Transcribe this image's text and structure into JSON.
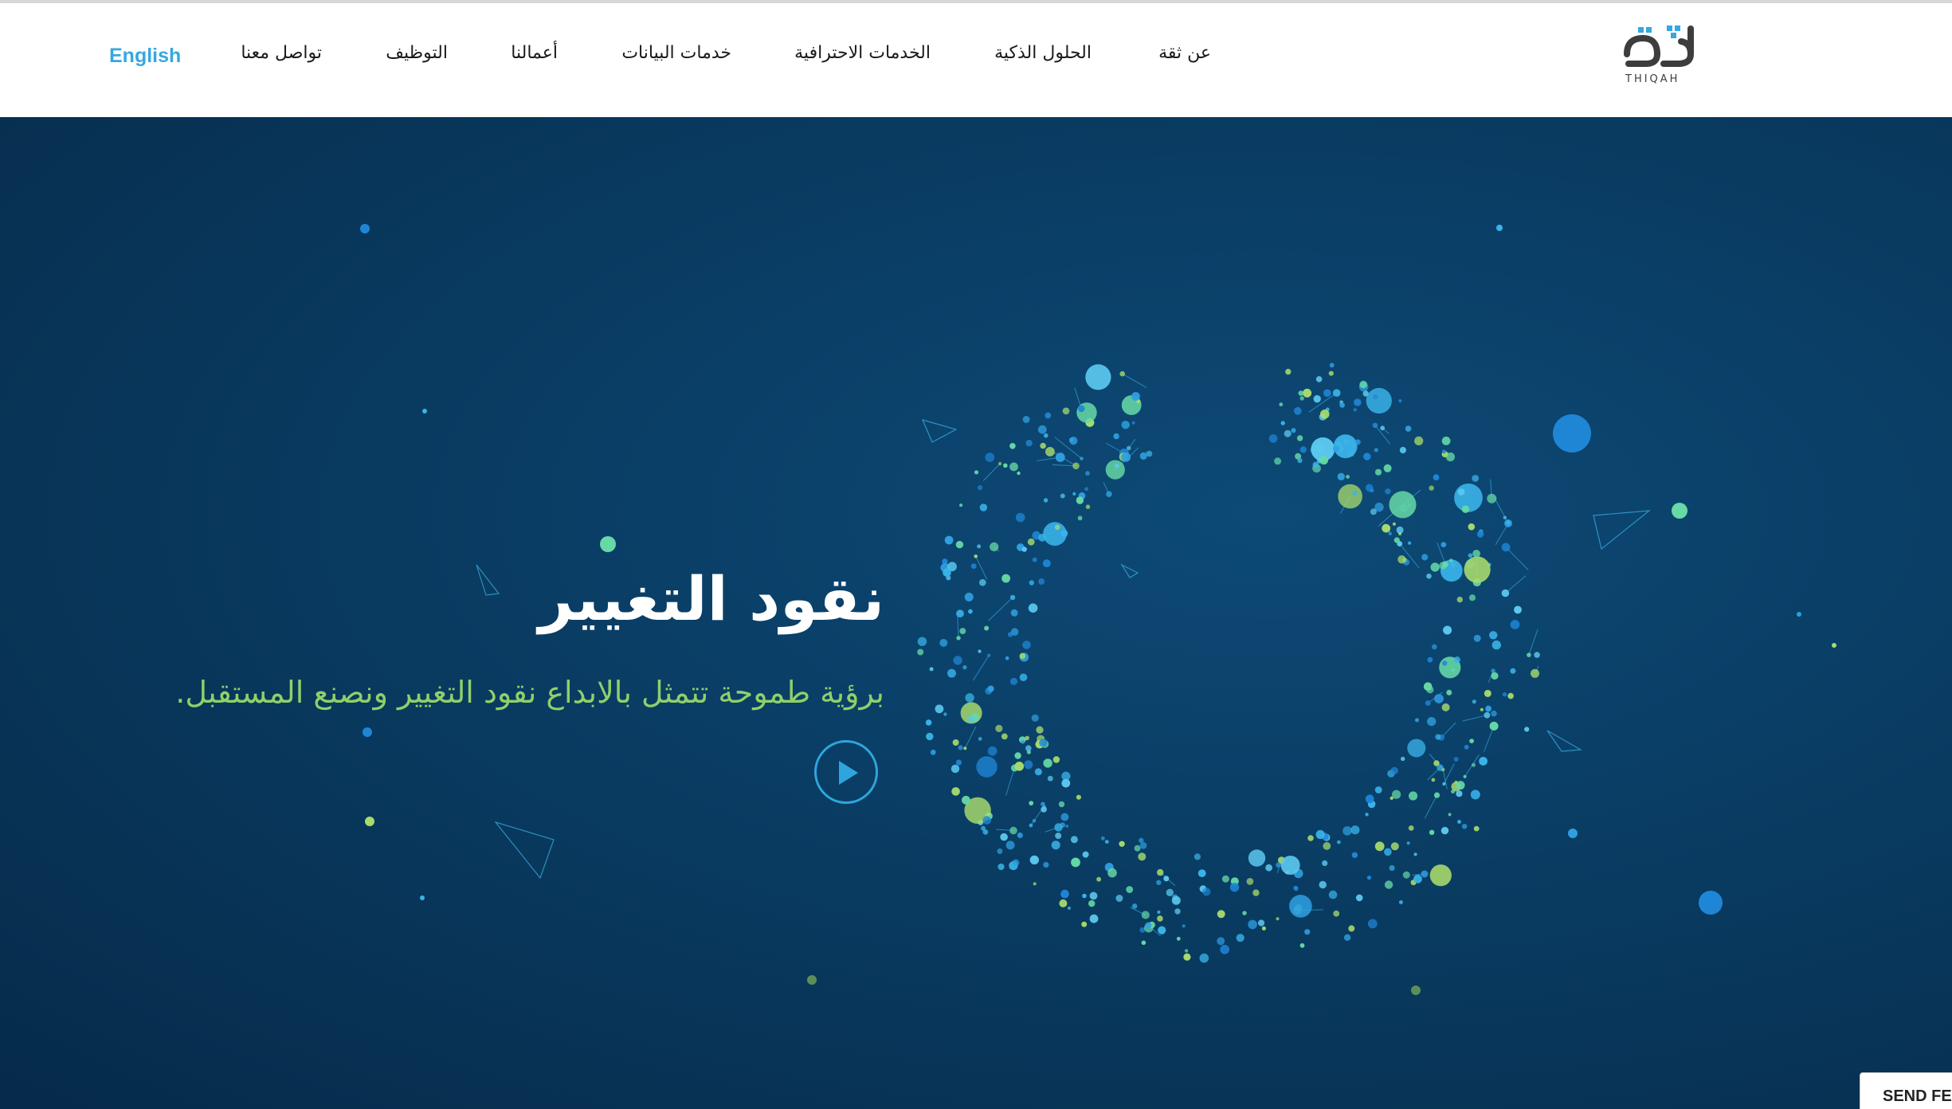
{
  "header": {
    "logo_text_ar": "ثقة",
    "logo_text_en": "THIQAH",
    "nav": [
      {
        "label": "عن ثقة"
      },
      {
        "label": "الحلول الذكية"
      },
      {
        "label": "الخدمات الاحترافية"
      },
      {
        "label": "خدمات البيانات"
      },
      {
        "label": "أعمالنا"
      },
      {
        "label": "التوظيف"
      },
      {
        "label": "تواصل معنا"
      }
    ],
    "language_label": "English"
  },
  "hero": {
    "title": "نقود التغيير",
    "subtitle": "برؤية طموحة تتمثل بالابداع نقود التغيير ونصنع المستقبل."
  },
  "feedback": {
    "label": "SEND FEEDBACK"
  },
  "colors": {
    "accent_blue": "#35a8e0",
    "hero_background": "#0a3f67",
    "subtitle_green": "#8fd06a"
  }
}
